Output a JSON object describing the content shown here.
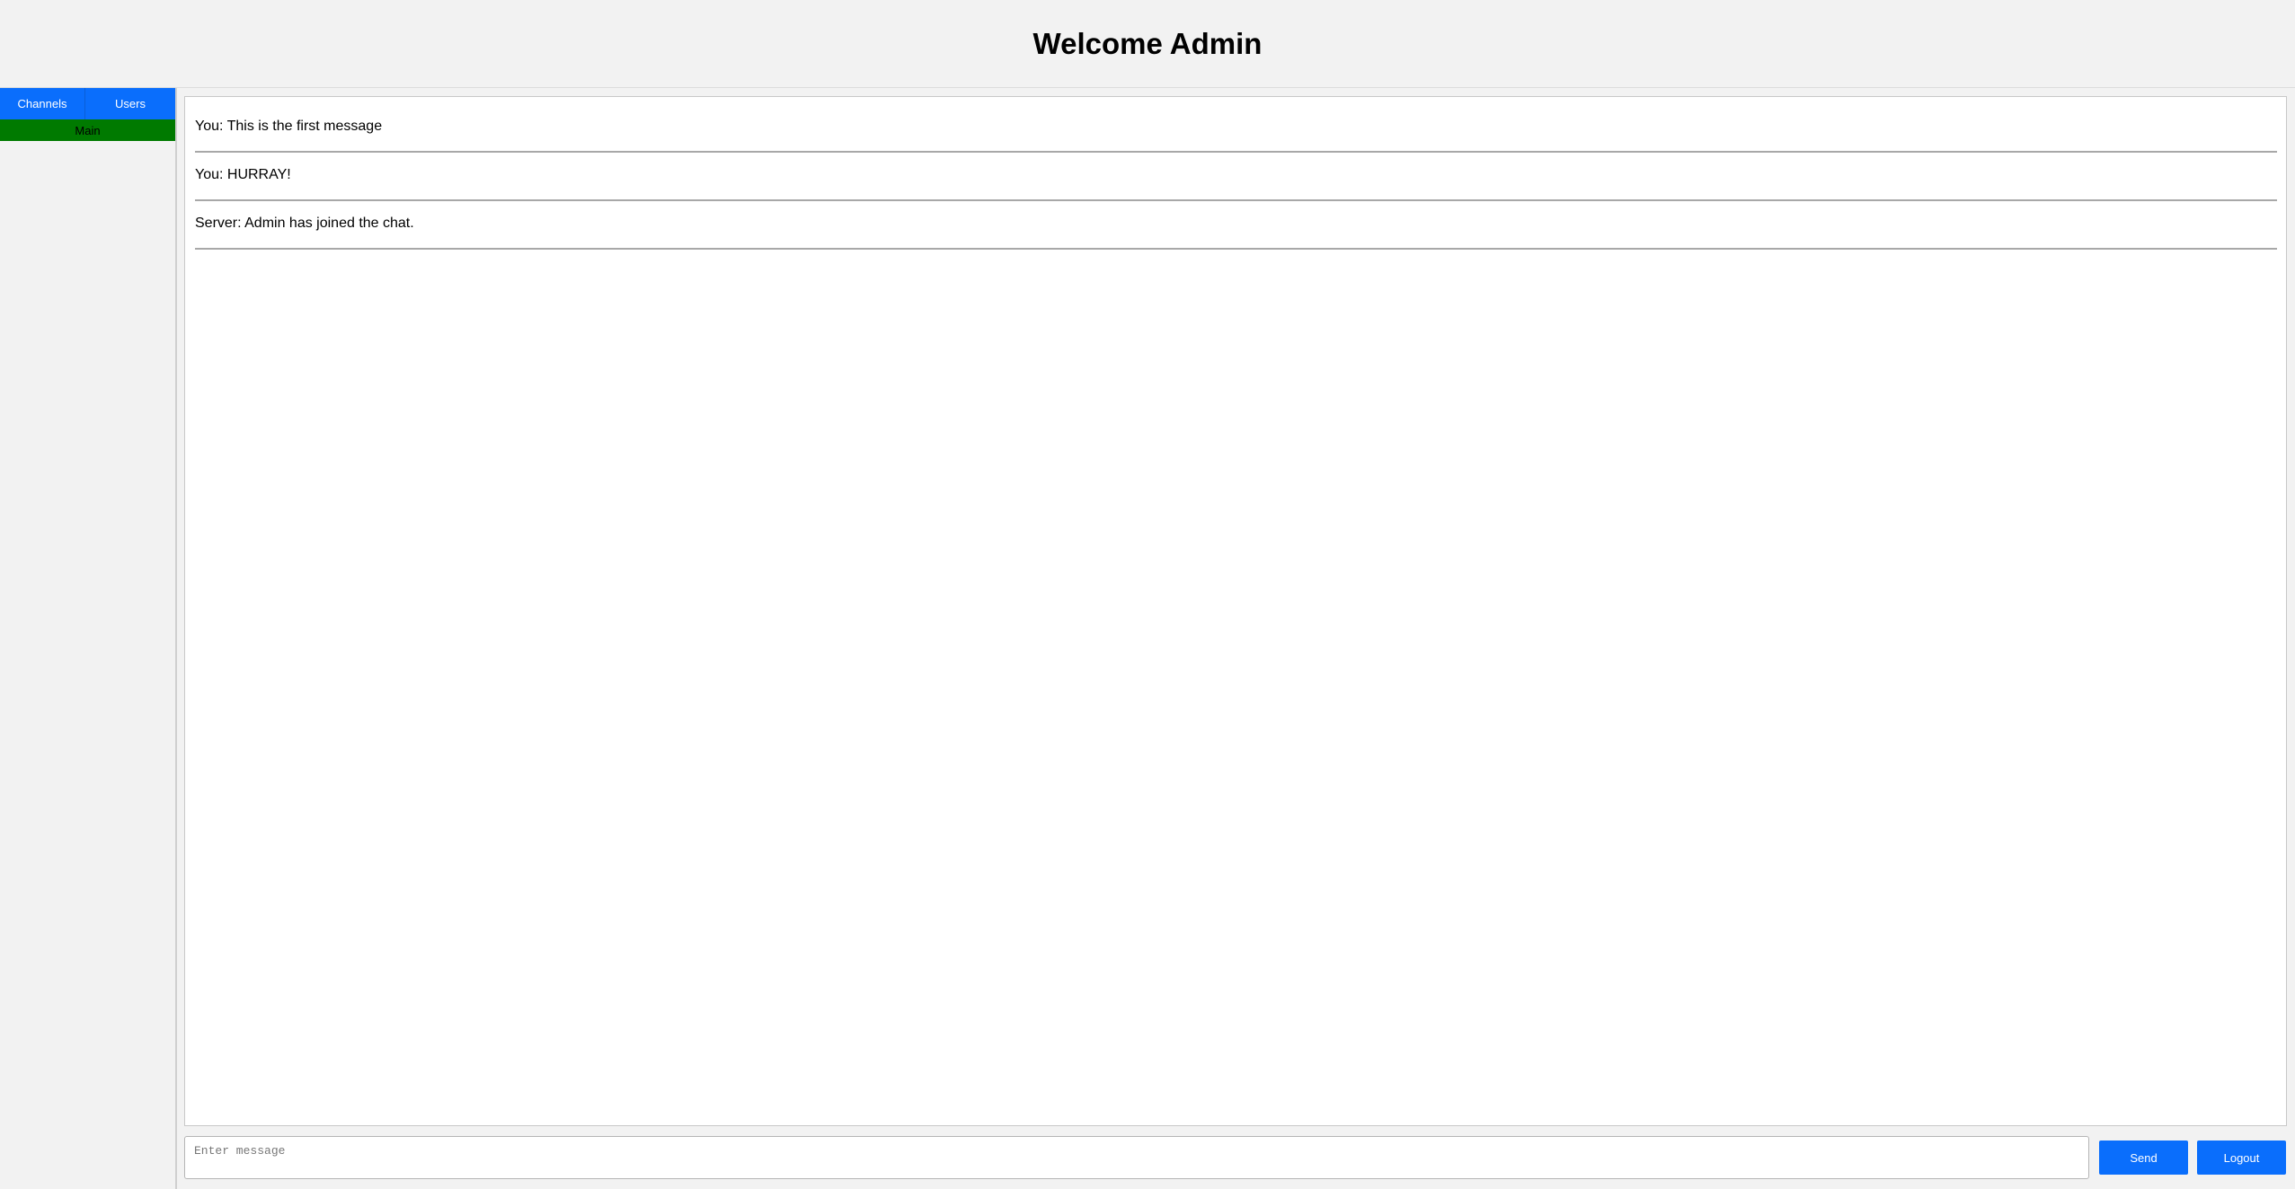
{
  "header": {
    "title": "Welcome Admin"
  },
  "sidebar": {
    "tabs": [
      {
        "label": "Channels"
      },
      {
        "label": "Users"
      }
    ],
    "channels": [
      {
        "label": "Main",
        "active": true
      }
    ]
  },
  "chat": {
    "messages": [
      {
        "text": "You: This is the first message"
      },
      {
        "text": "You: HURRAY!"
      },
      {
        "text": "Server: Admin has joined the chat."
      }
    ]
  },
  "composer": {
    "placeholder": "Enter message",
    "value": "",
    "send_label": "Send",
    "logout_label": "Logout"
  },
  "colors": {
    "accent": "#0a6efc",
    "active_channel": "#007a00",
    "background": "#f2f2f2"
  }
}
